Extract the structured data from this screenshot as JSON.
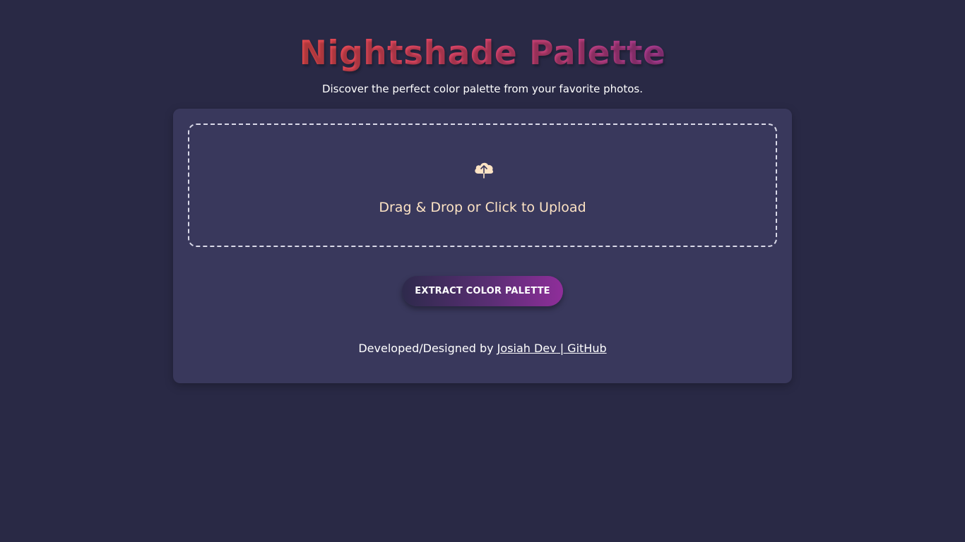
{
  "header": {
    "title": "Nightshade Palette",
    "subtitle": "Discover the perfect color palette from your favorite photos."
  },
  "upload": {
    "icon": "cloud-upload-icon",
    "label": "Drag & Drop or Click to Upload"
  },
  "actions": {
    "extract_label": "EXTRACT COLOR PALETTE"
  },
  "footer": {
    "prefix": "Developed/Designed by ",
    "author_link": "Josiah Dev",
    "github_link": " | GitHub"
  },
  "colors": {
    "background": "#292945",
    "card": "#39385c",
    "title_gradient_start": "#e84a4e",
    "title_gradient_end": "#a43a8f",
    "accent_text": "#fde3c4",
    "button_gradient_start": "#2e2a4c",
    "button_gradient_end": "#8f2e9a"
  }
}
